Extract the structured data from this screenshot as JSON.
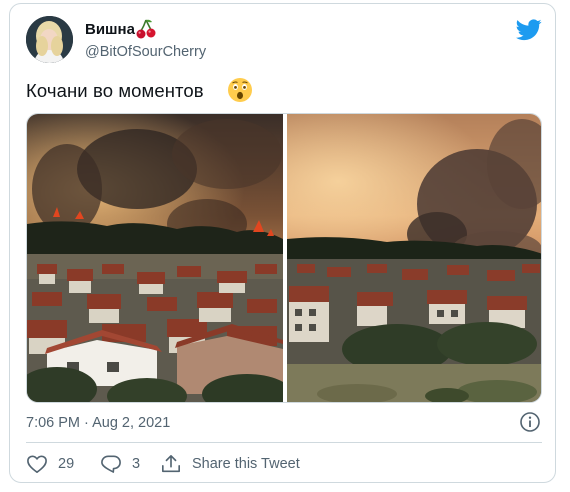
{
  "tweet": {
    "author": {
      "display_name": "Вишна",
      "handle": "@BitOfSourCherry",
      "name_emoji": "cherry"
    },
    "text": "Кочани во моментов",
    "text_emoji": "astonished-face",
    "media": {
      "count": 2,
      "description_icons": [
        "wildfire-photo-left",
        "wildfire-photo-right"
      ]
    },
    "timestamp": "7:06 PM · Aug 2, 2021",
    "actions": {
      "like_count": "29",
      "reply_count": "3",
      "share_label": "Share this Tweet"
    }
  },
  "colors": {
    "brand_blue": "#1d9bf0",
    "secondary_text": "#536471",
    "border": "#cfd9de"
  }
}
